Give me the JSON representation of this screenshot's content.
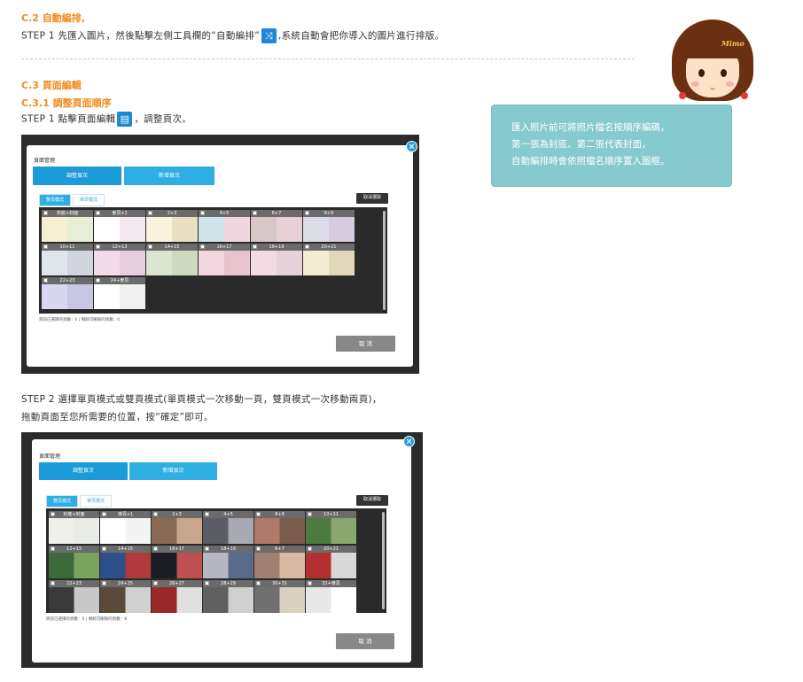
{
  "section_c2": {
    "heading": "C.2 自動編排,",
    "step1_before": "STEP 1 先匯入圖片，然後點擊左側工具欄的“自動編排”",
    "step1_after": ",系統自動會把你導入的圖片進行排版。",
    "shuffle_icon": "shuffle-icon"
  },
  "section_c3": {
    "heading": "C.3 頁面編輯",
    "subheading": "C.3.1 調整頁面順序",
    "step1_before": "STEP 1 點擊頁面編輯",
    "step1_after": "，調整頁次。",
    "page_edit_icon": "page-edit-icon",
    "step2_line1": "STEP 2 選擇單頁模式或雙頁模式(單頁模式一次移動一頁，雙頁模式一次移動兩頁)，",
    "step2_line2": "拖動頁面至您所需要的位置，按“確定”即可。"
  },
  "mascot": {
    "badge": "Mimo",
    "bubble_lines": [
      "匯入照片前可將照片檔名按順序編碼，",
      "第一張為封底、第二張代表封面，",
      "自動編排時會依照檔名順序置入圖框。"
    ]
  },
  "dialog1": {
    "title": "頁面管理",
    "tab_adjust": "調整頁次",
    "tab_add": "新增頁次",
    "mode_double": "雙頁模式",
    "mode_single": "單頁模式",
    "cancel_selection": "取消選取",
    "status": "目前已選擇的頁數：0 | 剩餘可刪除的頁數：0",
    "cancel": "取 消",
    "pages": [
      "封底+封面",
      "扉頁+1",
      "2+3",
      "4+5",
      "6+7",
      "8+9",
      "10+11",
      "12+13",
      "14+15",
      "16+17",
      "18+19",
      "20+21",
      "22+23",
      "24+扉頁"
    ]
  },
  "dialog2": {
    "title": "頁面管理",
    "tab_adjust": "調整頁次",
    "tab_add": "新增頁次",
    "mode_double": "雙頁模式",
    "mode_single": "單頁模式",
    "cancel_selection": "取消選取",
    "status": "目前已選擇的頁數：0 | 剩餘可刪除的頁數：8",
    "cancel": "取 消",
    "pages": [
      "封底+封面",
      "扉頁+1",
      "2+3",
      "4+5",
      "8+9",
      "10+11",
      "12+13",
      "14+15",
      "16+17",
      "18+19",
      "6+7",
      "20+21",
      "22+23",
      "24+25",
      "26+27",
      "28+29",
      "30+31",
      "32+扉頁"
    ]
  },
  "colors": {
    "accent_orange": "#f28a1e",
    "tab_blue": "#2eaee3",
    "bubble_teal": "#86c9cf"
  }
}
